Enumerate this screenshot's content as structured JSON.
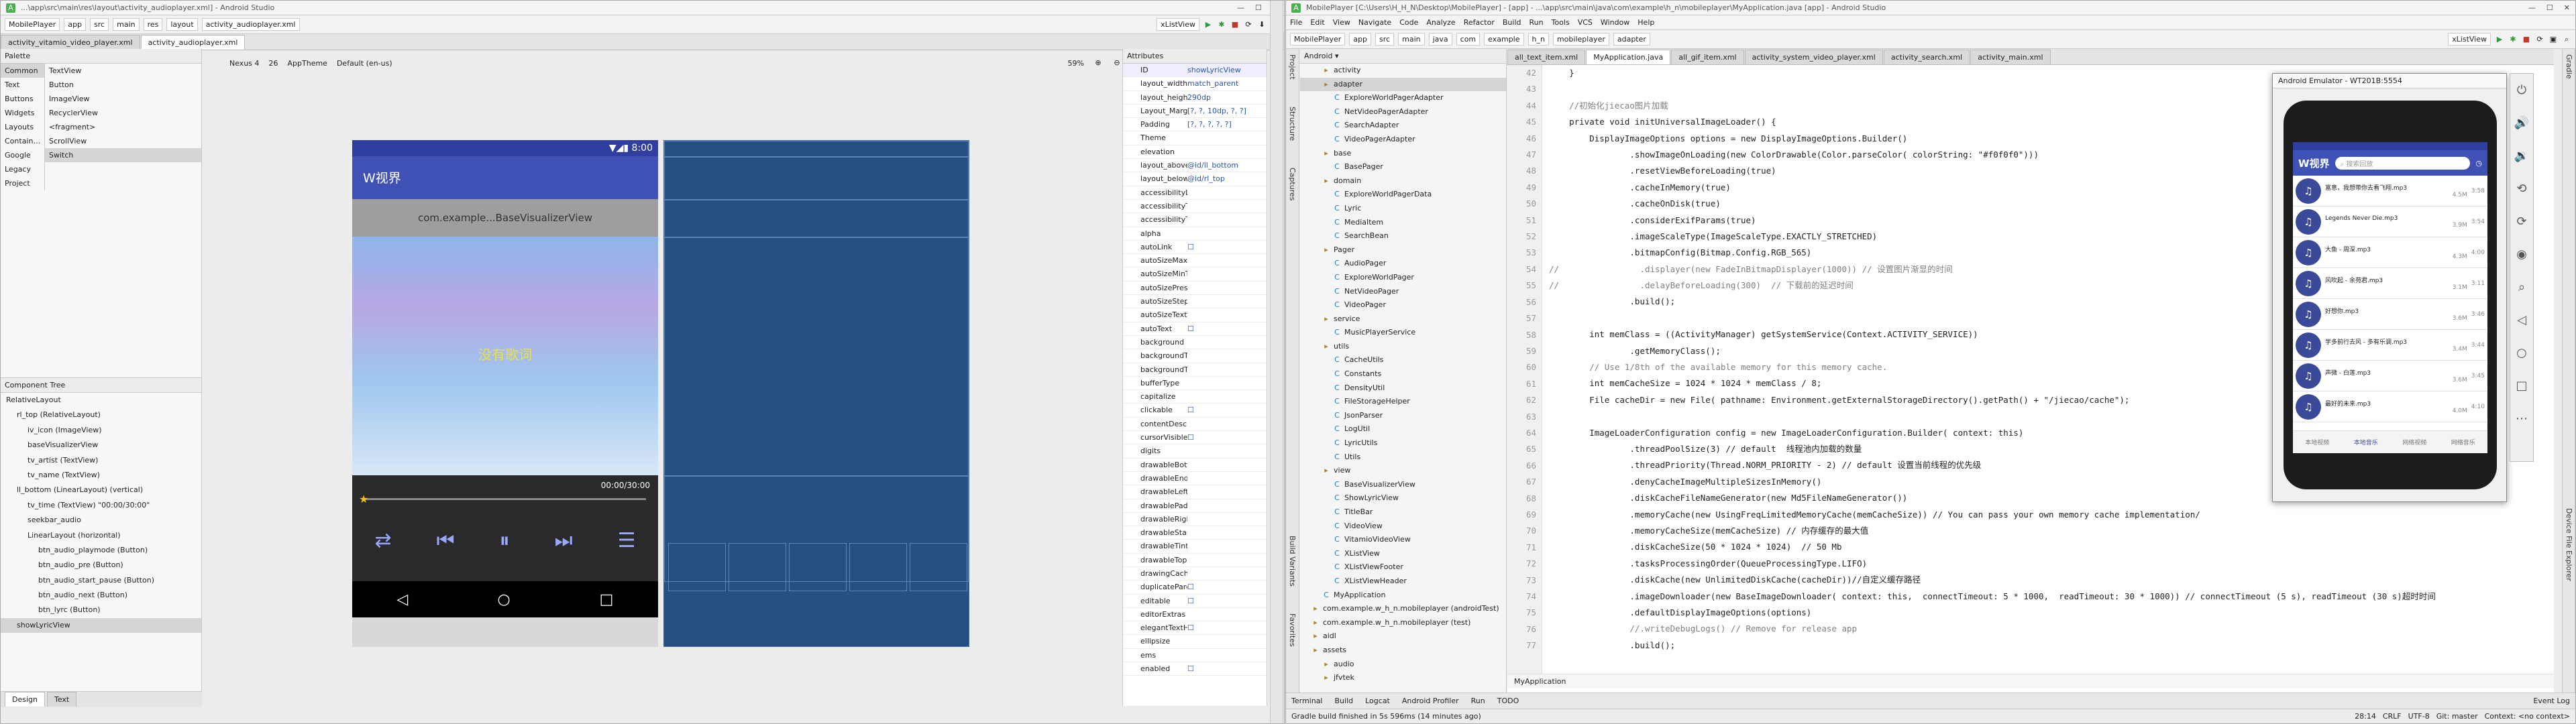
{
  "left_window": {
    "title": "...\\app\\src\\main\\res\\layout\\activity_audioplayer.xml] - Android Studio",
    "crumbs": [
      "MobilePlayer",
      "app",
      "src",
      "main",
      "res",
      "layout",
      "activity_audioplayer.xml"
    ],
    "run_config": "app",
    "device": "xListView",
    "tabs": [
      "activity_vitamio_video_player.xml",
      "activity_audioplayer.xml"
    ],
    "palette": {
      "title": "Palette",
      "categories": [
        "Common",
        "Text",
        "Buttons",
        "Widgets",
        "Layouts",
        "Containers",
        "Google",
        "Legacy",
        "Project"
      ],
      "items": [
        "TextView",
        "Button",
        "ImageView",
        "RecyclerView",
        "<fragment>",
        "ScrollView",
        "Switch"
      ]
    },
    "design_toolbar": {
      "nexus": "Nexus 4",
      "api": "26",
      "theme": "AppTheme",
      "locale": "Default (en-us)",
      "zoom": "59%"
    },
    "component_tree": {
      "title": "Component Tree",
      "nodes": [
        {
          "label": "RelativeLayout",
          "indent": 0
        },
        {
          "label": "rl_top (RelativeLayout)",
          "indent": 1
        },
        {
          "label": "iv_icon (ImageView)",
          "indent": 2
        },
        {
          "label": "baseVisualizerView",
          "indent": 2
        },
        {
          "label": "tv_artist (TextView)",
          "indent": 2
        },
        {
          "label": "tv_name (TextView)",
          "indent": 2
        },
        {
          "label": "ll_bottom (LinearLayout) (vertical)",
          "indent": 1
        },
        {
          "label": "tv_time (TextView) \"00:00/30:00\"",
          "indent": 2
        },
        {
          "label": "seekbar_audio",
          "indent": 2
        },
        {
          "label": "LinearLayout (horizontal)",
          "indent": 2
        },
        {
          "label": "btn_audio_playmode (Button)",
          "indent": 3
        },
        {
          "label": "btn_audio_pre (Button)",
          "indent": 3
        },
        {
          "label": "btn_audio_start_pause (Button)",
          "indent": 3
        },
        {
          "label": "btn_audio_next (Button)",
          "indent": 3
        },
        {
          "label": "btn_lyrc (Button)",
          "indent": 3
        },
        {
          "label": "showLyricView",
          "indent": 1
        }
      ]
    },
    "preview": {
      "time": "8:00",
      "app_title": "W视界",
      "visualizer": "com.example...BaseVisualizerView",
      "no_lyric": "没有歌词",
      "time_text": "00:00/30:00"
    },
    "design_tabs": [
      "Design",
      "Text"
    ],
    "attributes": {
      "title": "Attributes",
      "id_value": "showLyricView",
      "rows": [
        [
          "layout_width",
          "match_parent"
        ],
        [
          "layout_height",
          "290dp"
        ],
        [
          "Layout_Margi",
          "[?, ?, 10dp, ?, ?]"
        ],
        [
          "Padding",
          "[?, ?, ?, ?, ?]"
        ],
        [
          "Theme",
          ""
        ],
        [
          "elevation",
          ""
        ],
        [
          "layout_above",
          "@id/ll_bottom"
        ],
        [
          "layout_below",
          "@id/rl_top"
        ],
        [
          "accessibilityLi",
          ""
        ],
        [
          "accessibilityTr",
          ""
        ],
        [
          "accessibilityTr",
          ""
        ],
        [
          "alpha",
          ""
        ],
        [
          "autoLink",
          "☐"
        ],
        [
          "autoSizeMaxT",
          ""
        ],
        [
          "autoSizeMinT",
          ""
        ],
        [
          "autoSizePrese",
          ""
        ],
        [
          "autoSizeStepG",
          ""
        ],
        [
          "autoSizeTextT",
          ""
        ],
        [
          "autoText",
          "☐"
        ],
        [
          "background",
          ""
        ],
        [
          "backgroundT",
          ""
        ],
        [
          "backgroundT",
          ""
        ],
        [
          "bufferType",
          ""
        ],
        [
          "capitalize",
          ""
        ],
        [
          "clickable",
          "☐"
        ],
        [
          "contentDescri",
          ""
        ],
        [
          "cursorVisible",
          "☐"
        ],
        [
          "digits",
          ""
        ],
        [
          "drawableBott",
          ""
        ],
        [
          "drawableEnd",
          ""
        ],
        [
          "drawableLeft",
          ""
        ],
        [
          "drawablePadd",
          ""
        ],
        [
          "drawableRight",
          ""
        ],
        [
          "drawableStart",
          ""
        ],
        [
          "drawableTint",
          ""
        ],
        [
          "drawableTop",
          ""
        ],
        [
          "drawingCache",
          ""
        ],
        [
          "duplicateParer",
          "☐"
        ],
        [
          "editable",
          "☐"
        ],
        [
          "editorExtras",
          ""
        ],
        [
          "elegantTextHe",
          "☐"
        ],
        [
          "ellipsize",
          ""
        ],
        [
          "ems",
          ""
        ],
        [
          "enabled",
          "☐"
        ]
      ]
    },
    "status": ""
  },
  "right_window": {
    "title": "MobilePlayer [C:\\Users\\H_H_N\\Desktop\\MobilePlayer] - [app] - ...\\app\\src\\main\\java\\com\\example\\h_n\\mobileplayer\\MyApplication.java [app] - Android Studio",
    "menu": [
      "File",
      "Edit",
      "View",
      "Navigate",
      "Code",
      "Analyze",
      "Refactor",
      "Build",
      "Run",
      "Tools",
      "VCS",
      "Window",
      "Help"
    ],
    "crumbs": [
      "MobilePlayer",
      "app",
      "src",
      "main",
      "java",
      "com",
      "example",
      "h_n",
      "mobileplayer",
      "adapter"
    ],
    "run_config": "app",
    "device": "xListView",
    "project_header": "Android",
    "tree": [
      {
        "label": "activity",
        "indent": 1,
        "kind": "folder"
      },
      {
        "label": "adapter",
        "indent": 1,
        "kind": "folder",
        "selected": true
      },
      {
        "label": "ExploreWorldPagerAdapter",
        "indent": 2,
        "kind": "class"
      },
      {
        "label": "NetVideoPagerAdapter",
        "indent": 2,
        "kind": "class"
      },
      {
        "label": "SearchAdapter",
        "indent": 2,
        "kind": "class"
      },
      {
        "label": "VideoPagerAdapter",
        "indent": 2,
        "kind": "class"
      },
      {
        "label": "base",
        "indent": 1,
        "kind": "folder"
      },
      {
        "label": "BasePager",
        "indent": 2,
        "kind": "class"
      },
      {
        "label": "domain",
        "indent": 1,
        "kind": "folder"
      },
      {
        "label": "ExploreWorldPagerData",
        "indent": 2,
        "kind": "class"
      },
      {
        "label": "Lyric",
        "indent": 2,
        "kind": "class"
      },
      {
        "label": "MediaItem",
        "indent": 2,
        "kind": "class"
      },
      {
        "label": "SearchBean",
        "indent": 2,
        "kind": "class"
      },
      {
        "label": "Pager",
        "indent": 1,
        "kind": "folder"
      },
      {
        "label": "AudioPager",
        "indent": 2,
        "kind": "class"
      },
      {
        "label": "ExploreWorldPager",
        "indent": 2,
        "kind": "class"
      },
      {
        "label": "NetVideoPager",
        "indent": 2,
        "kind": "class"
      },
      {
        "label": "VideoPager",
        "indent": 2,
        "kind": "class"
      },
      {
        "label": "service",
        "indent": 1,
        "kind": "folder"
      },
      {
        "label": "MusicPlayerService",
        "indent": 2,
        "kind": "class"
      },
      {
        "label": "utils",
        "indent": 1,
        "kind": "folder"
      },
      {
        "label": "CacheUtils",
        "indent": 2,
        "kind": "class"
      },
      {
        "label": "Constants",
        "indent": 2,
        "kind": "class"
      },
      {
        "label": "DensityUtil",
        "indent": 2,
        "kind": "class"
      },
      {
        "label": "FileStorageHelper",
        "indent": 2,
        "kind": "class"
      },
      {
        "label": "JsonParser",
        "indent": 2,
        "kind": "class"
      },
      {
        "label": "LogUtil",
        "indent": 2,
        "kind": "class"
      },
      {
        "label": "LyricUtils",
        "indent": 2,
        "kind": "class"
      },
      {
        "label": "Utils",
        "indent": 2,
        "kind": "class"
      },
      {
        "label": "view",
        "indent": 1,
        "kind": "folder"
      },
      {
        "label": "BaseVisualizerView",
        "indent": 2,
        "kind": "class"
      },
      {
        "label": "ShowLyricView",
        "indent": 2,
        "kind": "class"
      },
      {
        "label": "TitleBar",
        "indent": 2,
        "kind": "class"
      },
      {
        "label": "VideoView",
        "indent": 2,
        "kind": "class"
      },
      {
        "label": "VitamioVideoView",
        "indent": 2,
        "kind": "class"
      },
      {
        "label": "XListView",
        "indent": 2,
        "kind": "class"
      },
      {
        "label": "XListViewFooter",
        "indent": 2,
        "kind": "class"
      },
      {
        "label": "XListViewHeader",
        "indent": 2,
        "kind": "class"
      },
      {
        "label": "MyApplication",
        "indent": 1,
        "kind": "class"
      },
      {
        "label": "com.example.w_h_n.mobileplayer (androidTest)",
        "indent": 0,
        "kind": "folder"
      },
      {
        "label": "com.example.w_h_n.mobileplayer (test)",
        "indent": 0,
        "kind": "folder"
      },
      {
        "label": "aidl",
        "indent": 0,
        "kind": "folder"
      },
      {
        "label": "assets",
        "indent": 0,
        "kind": "folder"
      },
      {
        "label": "audio",
        "indent": 1,
        "kind": "folder"
      },
      {
        "label": "jfvtek",
        "indent": 1,
        "kind": "folder"
      }
    ],
    "editor_tabs": [
      "all_text_item.xml",
      "MyApplication.java",
      "all_gif_item.xml",
      "activity_system_video_player.xml",
      "activity_search.xml",
      "activity_main.xml"
    ],
    "line_start": 42,
    "code_lines": [
      "    }",
      "",
      "    //初始化jiecao图片加载",
      "    private void initUniversalImageLoader() {",
      "        DisplayImageOptions options = new DisplayImageOptions.Builder()",
      "                .showImageOnLoading(new ColorDrawable(Color.parseColor( colorString: \"#f0f0f0\")))",
      "                .resetViewBeforeLoading(true)",
      "                .cacheInMemory(true)",
      "                .cacheOnDisk(true)",
      "                .considerExifParams(true)",
      "                .imageScaleType(ImageScaleType.EXACTLY_STRETCHED)",
      "                .bitmapConfig(Bitmap.Config.RGB_565)",
      "//                .displayer(new FadeInBitmapDisplayer(1000)) // 设置图片渐显的时间",
      "//                .delayBeforeLoading(300)  // 下载前的延迟时间",
      "                .build();",
      "",
      "        int memClass = ((ActivityManager) getSystemService(Context.ACTIVITY_SERVICE))",
      "                .getMemoryClass();",
      "        // Use 1/8th of the available memory for this memory cache.",
      "        int memCacheSize = 1024 * 1024 * memClass / 8;",
      "        File cacheDir = new File( pathname: Environment.getExternalStorageDirectory().getPath() + \"/jiecao/cache\");",
      "",
      "        ImageLoaderConfiguration config = new ImageLoaderConfiguration.Builder( context: this)",
      "                .threadPoolSize(3) // default  线程池内加载的数量",
      "                .threadPriority(Thread.NORM_PRIORITY - 2) // default 设置当前线程的优先级",
      "                .denyCacheImageMultipleSizesInMemory()",
      "                .diskCacheFileNameGenerator(new Md5FileNameGenerator())",
      "                .memoryCache(new UsingFreqLimitedMemoryCache(memCacheSize)) // You can pass your own memory cache implementation/",
      "                .memoryCacheSize(memCacheSize) // 内存缓存的最大值",
      "                .diskCacheSize(50 * 1024 * 1024)  // 50 Mb",
      "                .tasksProcessingOrder(QueueProcessingType.LIFO)",
      "                .diskCache(new UnlimitedDiskCache(cacheDir))//自定义缓存路径",
      "                .imageDownloader(new BaseImageDownloader( context: this,  connectTimeout: 5 * 1000,  readTimeout: 30 * 1000)) // connectTimeout (5 s), readTimeout (30 s)超时时间",
      "                .defaultDisplayImageOptions(options)",
      "                //.writeDebugLogs() // Remove for release app",
      "                .build();"
    ],
    "breadcrumb_bottom": "MyApplication",
    "bottom_tools": [
      "Terminal",
      "Build",
      "Logcat",
      "Android Profiler",
      "Run",
      "TODO"
    ],
    "event_log": "Event Log",
    "status": "Gradle build finished in 5s 596ms (14 minutes ago)",
    "status_right": [
      "28:14",
      "CRLF",
      "UTF-8",
      "Git: master",
      "Context: <no context>"
    ],
    "left_stripe": [
      "Project",
      "Structure",
      "Captures",
      "Build Variants",
      "Favorites"
    ],
    "right_stripe": [
      "Gradle",
      "Device File Explorer"
    ]
  },
  "emulator": {
    "title": "Android Emulator - WT201B:5554",
    "app_title": "W视界",
    "search_placeholder": "搜索回放",
    "songs": [
      {
        "name": "富意，我想带你去看飞翔.mp3",
        "size": "4.5M",
        "time": "3:58"
      },
      {
        "name": "Legends Never Die.mp3",
        "size": "3.9M",
        "time": "3:54"
      },
      {
        "name": "大鱼 - 周深.mp3",
        "size": "4.3M",
        "time": "4:00"
      },
      {
        "name": "风吹起 - 余苑君.mp3",
        "size": "3.1M",
        "time": "3:11"
      },
      {
        "name": "好想你.mp3",
        "size": "3.6M",
        "time": "3:46"
      },
      {
        "name": "学多前行去风 - 多有乐调.mp3",
        "size": "3.4M",
        "time": "3:44"
      },
      {
        "name": "声微 - 白莲.mp3",
        "size": "3.6M",
        "time": "3:45"
      },
      {
        "name": "最好的未来.mp3",
        "size": "4.0M",
        "time": "4:10"
      }
    ],
    "bottom_tabs": [
      "本地视频",
      "本地音乐",
      "网络视频",
      "网络音乐"
    ]
  }
}
